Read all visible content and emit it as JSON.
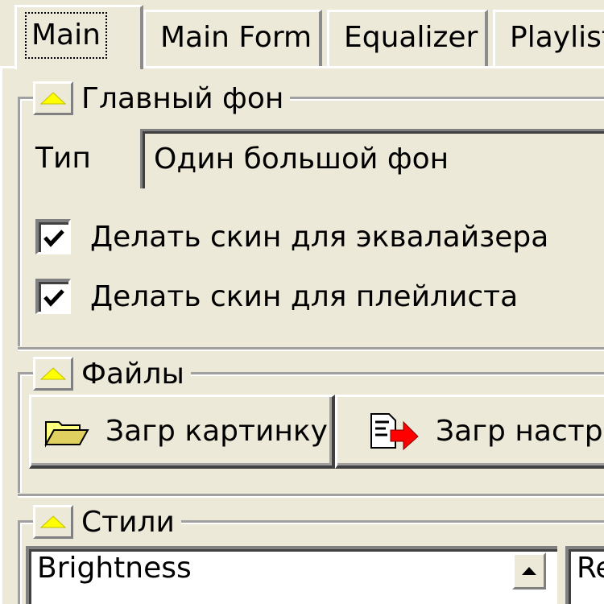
{
  "tabs": [
    {
      "label": "Main",
      "active": true
    },
    {
      "label": "Main Form",
      "active": false
    },
    {
      "label": "Equalizer",
      "active": false
    },
    {
      "label": "Playlist",
      "active": false
    }
  ],
  "main_background": {
    "title": "Главный фон",
    "type_label": "Тип",
    "type_value": "Один большой фон",
    "checkboxes": [
      {
        "label": "Делать скин для эквалайзера",
        "checked": true
      },
      {
        "label": "Делать скин для плейлиста",
        "checked": true
      }
    ]
  },
  "files": {
    "title": "Файлы",
    "load_image_label": "Загр картинку",
    "load_settings_label": "Загр настр."
  },
  "styles": {
    "title": "Стили",
    "list_items": [
      "Brightness"
    ],
    "right_list_items": [
      "Re"
    ]
  },
  "colors": {
    "face": "#ece9d8",
    "highlight": "#ffffff",
    "shadow": "#808080",
    "triangle": "#ffff00",
    "arrow_red": "#ff0000"
  }
}
